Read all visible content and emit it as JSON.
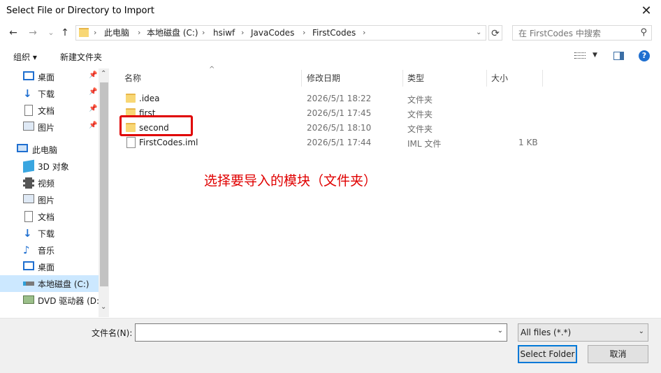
{
  "window": {
    "title": "Select File or Directory to Import"
  },
  "nav": {
    "back": "←",
    "forward": "→",
    "history": "⌄",
    "up": "↑",
    "refresh": "⟳",
    "breadcrumbs": [
      "此电脑",
      "本地磁盘 (C:)",
      "hsiwf",
      "JavaCodes",
      "FirstCodes"
    ],
    "search_placeholder": "在 FirstCodes 中搜索"
  },
  "toolbar": {
    "organize": "组织 ▾",
    "new_folder": "新建文件夹"
  },
  "sidebar": {
    "quick": [
      {
        "label": "桌面",
        "icon": "desktop-icon"
      },
      {
        "label": "下载",
        "icon": "download-icon"
      },
      {
        "label": "文档",
        "icon": "document-icon"
      },
      {
        "label": "图片",
        "icon": "pictures-icon"
      }
    ],
    "this_pc": "此电脑",
    "pc_items": [
      {
        "label": "3D 对象",
        "icon": "cube-icon"
      },
      {
        "label": "视频",
        "icon": "video-icon"
      },
      {
        "label": "图片",
        "icon": "pictures-icon"
      },
      {
        "label": "文档",
        "icon": "document-icon"
      },
      {
        "label": "下载",
        "icon": "download-icon"
      },
      {
        "label": "音乐",
        "icon": "music-icon"
      },
      {
        "label": "桌面",
        "icon": "desktop-icon"
      },
      {
        "label": "本地磁盘 (C:)",
        "icon": "drive-icon"
      },
      {
        "label": "DVD 驱动器 (D:",
        "icon": "dvd-icon"
      }
    ]
  },
  "columns": [
    "名称",
    "修改日期",
    "类型",
    "大小"
  ],
  "files": [
    {
      "name": ".idea",
      "date": "2026/5/1 18:22",
      "type": "文件夹",
      "size": "",
      "kind": "folder"
    },
    {
      "name": "first",
      "date": "2026/5/1 17:45",
      "type": "文件夹",
      "size": "",
      "kind": "folder"
    },
    {
      "name": "second",
      "date": "2026/5/1 18:10",
      "type": "文件夹",
      "size": "",
      "kind": "folder"
    },
    {
      "name": "FirstCodes.iml",
      "date": "2026/5/1 17:44",
      "type": "IML 文件",
      "size": "1 KB",
      "kind": "file"
    }
  ],
  "annotation": "选择要导入的模块（文件夹）",
  "bottom": {
    "filename_label": "文件名(N):",
    "filename_value": "",
    "filter": "All files (*.*)",
    "ok": "Select Folder",
    "cancel": "取消"
  },
  "colors": {
    "accent": "#0078d7",
    "annotation": "#e00000",
    "folder": "#f8d775"
  }
}
